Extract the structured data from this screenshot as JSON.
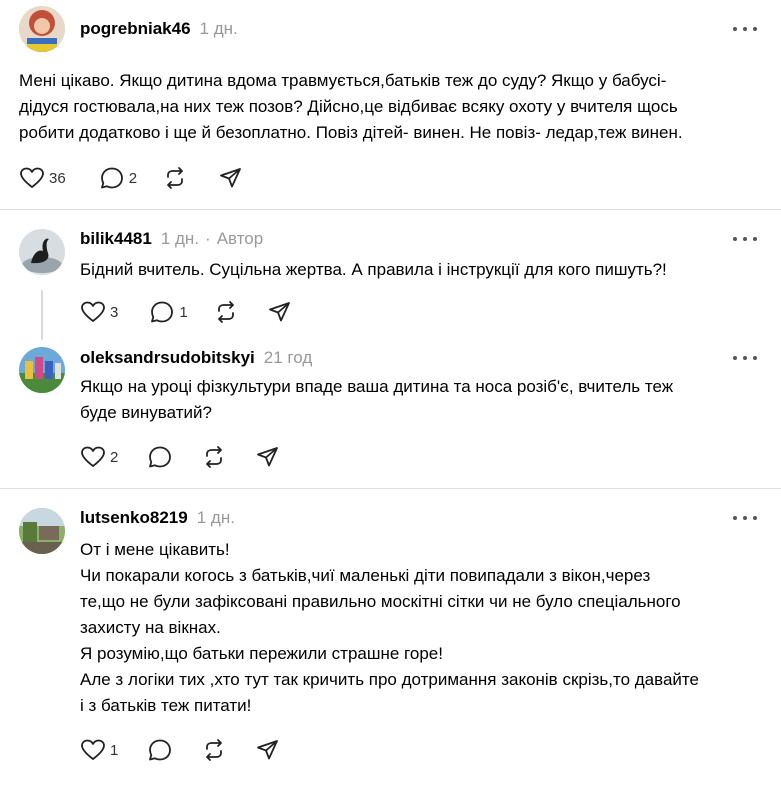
{
  "colors": {
    "meta": "#999999",
    "divider": "#e0e0e0",
    "icon": "#222222"
  },
  "posts": [
    {
      "username": "pogrebniak46",
      "time": "1 дн.",
      "text_lines": [
        "Мені цікаво. Якщо дитина вдома травмується,батьків теж до суду? Якщо у бабусі-",
        "дідуся гостювала,на них теж позов? Дійсно,це відбиває всяку охоту у вчителя щось",
        "робити додатково і ще й безоплатно. Повіз дітей- винен. Не повіз- ледар,теж винен."
      ],
      "likes": "36",
      "replies": "2"
    },
    {
      "username": "bilik4481",
      "time": "1 дн.",
      "separator": "·",
      "badge": "Автор",
      "text_lines": [
        "Бідний вчитель. Суцільна жертва. А правила і інструкції для кого пишуть?!"
      ],
      "likes": "3",
      "replies": "1"
    },
    {
      "username": "oleksandrsudobitskyi",
      "time": "21 год",
      "text_lines": [
        "Якщо на уроці фізкультури впаде ваша дитина та носа розіб'є, вчитель теж",
        "буде винуватий?"
      ],
      "likes": "2"
    },
    {
      "username": "lutsenko8219",
      "time": "1 дн.",
      "text_lines": [
        "От і мене цікавить!",
        "Чи покарали когось з батьків,чиї маленькі діти повипадали з вікон,через",
        "те,що не були зафіксовані правильно москітні сітки чи не було спеціального",
        "захисту на вікнах.",
        "Я розумію,що батьки пережили страшне горе!",
        "Але з логіки тих ,хто тут так кричить про дотримання законів скрізь,то давайте",
        "і з батьків теж питати!"
      ],
      "likes": "1"
    }
  ]
}
